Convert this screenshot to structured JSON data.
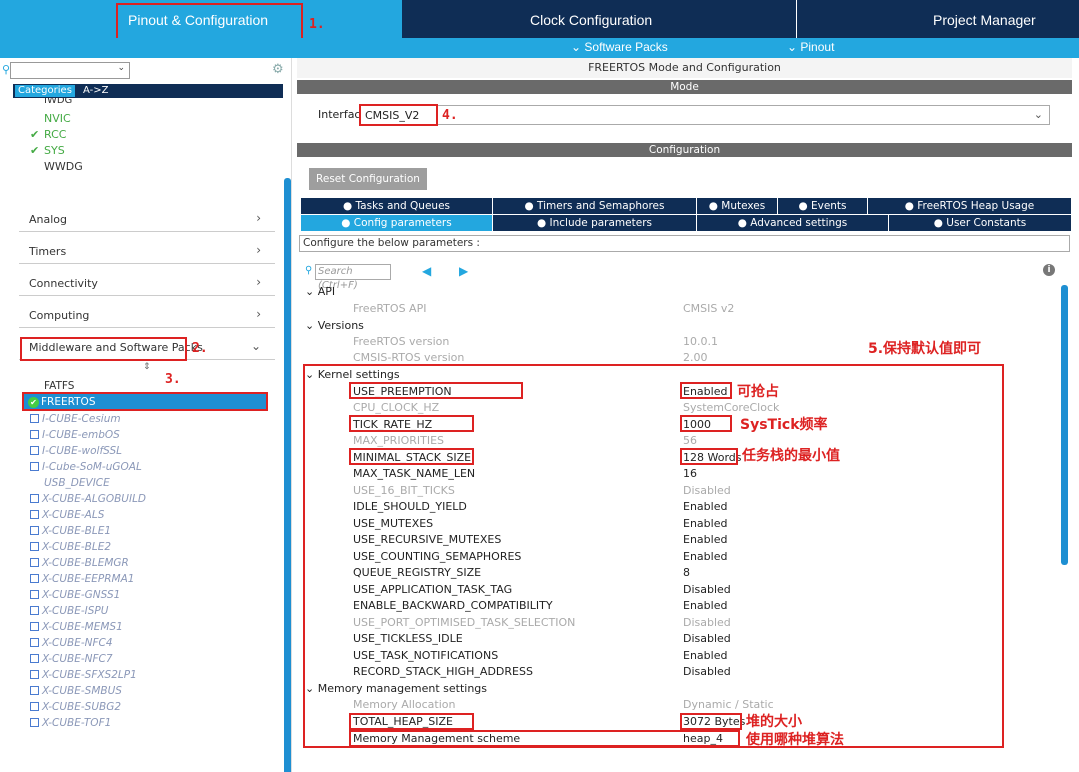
{
  "tabs": {
    "pinout": "Pinout & Configuration",
    "clock": "Clock Configuration",
    "project": "Project Manager"
  },
  "subtabs": {
    "software_packs": "Software Packs",
    "pinout": "Pinout"
  },
  "steps": {
    "s1": "1.",
    "s2": "2.",
    "s3": "3.",
    "s4": "4.",
    "s5": "5.保持默认值即可"
  },
  "left": {
    "cat_tab": "Categories",
    "az_tab": "A->Z",
    "sys_items": [
      {
        "label": "IWDG",
        "checked": false
      },
      {
        "label": "NVIC",
        "checked": false
      },
      {
        "label": "RCC",
        "checked": true
      },
      {
        "label": "SYS",
        "checked": true
      },
      {
        "label": "WWDG",
        "checked": false
      }
    ],
    "sections": [
      "Analog",
      "Timers",
      "Connectivity",
      "Computing",
      "Middleware and Software Packs"
    ],
    "packs": [
      "FATFS",
      "FREERTOS",
      "I-CUBE-Cesium",
      "I-CUBE-embOS",
      "I-CUBE-wolfSSL",
      "I-Cube-SoM-uGOAL",
      "USB_DEVICE",
      "X-CUBE-ALGOBUILD",
      "X-CUBE-ALS",
      "X-CUBE-BLE1",
      "X-CUBE-BLE2",
      "X-CUBE-BLEMGR",
      "X-CUBE-EEPRMA1",
      "X-CUBE-GNSS1",
      "X-CUBE-ISPU",
      "X-CUBE-MEMS1",
      "X-CUBE-NFC4",
      "X-CUBE-NFC7",
      "X-CUBE-SFXS2LP1",
      "X-CUBE-SMBUS",
      "X-CUBE-SUBG2",
      "X-CUBE-TOF1"
    ]
  },
  "right": {
    "title": "FREERTOS Mode and Configuration",
    "mode_header": "Mode",
    "interface_label": "Interface",
    "interface_value": "CMSIS_V2",
    "config_header": "Configuration",
    "reset_button": "Reset Configuration",
    "tabs_row1": [
      "Tasks and Queues",
      "Timers and Semaphores",
      "Mutexes",
      "Events",
      "FreeRTOS Heap Usage"
    ],
    "tabs_row2": [
      "Config parameters",
      "Include parameters",
      "Advanced settings",
      "User Constants"
    ],
    "configure_text": "Configure the below parameters :",
    "search_placeholder": "Search (Ctrl+F)",
    "groups": {
      "api": "API",
      "versions": "Versions",
      "kernel": "Kernel settings",
      "memory": "Memory management settings"
    },
    "params": [
      {
        "name": "FreeRTOS API",
        "value": "CMSIS v2",
        "disabled": true
      },
      {
        "name": "FreeRTOS version",
        "value": "10.0.1",
        "disabled": true
      },
      {
        "name": "CMSIS-RTOS version",
        "value": "2.00",
        "disabled": true
      },
      {
        "name": "USE_PREEMPTION",
        "value": "Enabled",
        "disabled": false
      },
      {
        "name": "CPU_CLOCK_HZ",
        "value": "SystemCoreClock",
        "disabled": true
      },
      {
        "name": "TICK_RATE_HZ",
        "value": "1000",
        "disabled": false
      },
      {
        "name": "MAX_PRIORITIES",
        "value": "56",
        "disabled": true
      },
      {
        "name": "MINIMAL_STACK_SIZE",
        "value": "128 Words",
        "disabled": false
      },
      {
        "name": "MAX_TASK_NAME_LEN",
        "value": "16",
        "disabled": false
      },
      {
        "name": "USE_16_BIT_TICKS",
        "value": "Disabled",
        "disabled": true
      },
      {
        "name": "IDLE_SHOULD_YIELD",
        "value": "Enabled",
        "disabled": false
      },
      {
        "name": "USE_MUTEXES",
        "value": "Enabled",
        "disabled": false
      },
      {
        "name": "USE_RECURSIVE_MUTEXES",
        "value": "Enabled",
        "disabled": false
      },
      {
        "name": "USE_COUNTING_SEMAPHORES",
        "value": "Enabled",
        "disabled": false
      },
      {
        "name": "QUEUE_REGISTRY_SIZE",
        "value": "8",
        "disabled": false
      },
      {
        "name": "USE_APPLICATION_TASK_TAG",
        "value": "Disabled",
        "disabled": false
      },
      {
        "name": "ENABLE_BACKWARD_COMPATIBILITY",
        "value": "Enabled",
        "disabled": false
      },
      {
        "name": "USE_PORT_OPTIMISED_TASK_SELECTION",
        "value": "Disabled",
        "disabled": true
      },
      {
        "name": "USE_TICKLESS_IDLE",
        "value": "Disabled",
        "disabled": false
      },
      {
        "name": "USE_TASK_NOTIFICATIONS",
        "value": "Enabled",
        "disabled": false
      },
      {
        "name": "RECORD_STACK_HIGH_ADDRESS",
        "value": "Disabled",
        "disabled": false
      },
      {
        "name": "Memory Allocation",
        "value": "Dynamic / Static",
        "disabled": true
      },
      {
        "name": "TOTAL_HEAP_SIZE",
        "value": "3072 Bytes",
        "disabled": false
      },
      {
        "name": "Memory Management scheme",
        "value": "heap_4",
        "disabled": false
      }
    ],
    "notes": {
      "preempt": "可抢占",
      "tick": "SysTick频率",
      "stack": "任务栈的最小值",
      "heap": "堆的大小",
      "scheme": "使用哪种堆算法"
    }
  }
}
